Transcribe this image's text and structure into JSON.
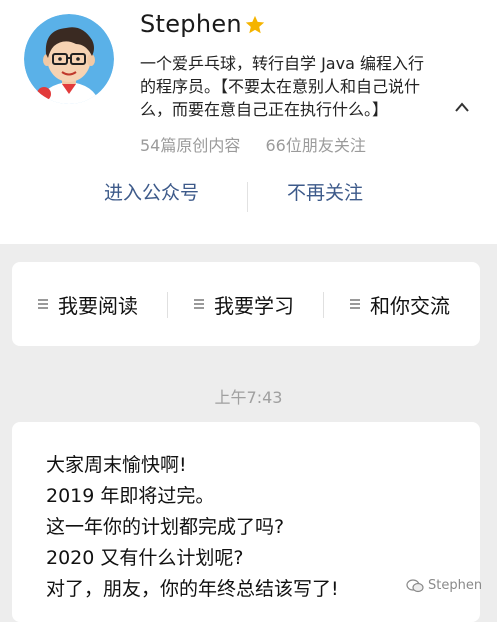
{
  "profile": {
    "name": "Stephen",
    "bio_line1": "一个爱乒乓球，转行自学 Java 编程入行",
    "bio_line2": "的程序员。【不要太在意别人和自己说什",
    "bio_line3": "么，而要在意自己正在执行什么。】",
    "original_count": "54篇原创内容",
    "friends_follow": "66位朋友关注"
  },
  "actions": {
    "enter": "进入公众号",
    "unfollow": "不再关注"
  },
  "menu": [
    {
      "label": "我要阅读"
    },
    {
      "label": "我要学习"
    },
    {
      "label": "和你交流"
    }
  ],
  "chat": {
    "time": "上午7:43",
    "lines": [
      "大家周末愉快啊!",
      "2019 年即将过完。",
      "这一年你的计划都完成了吗?",
      "2020 又有什么计划呢?",
      "对了，朋友，你的年终总结该写了!"
    ]
  },
  "watermark": {
    "text": "Stephen"
  },
  "colors": {
    "link": "#3d5a8a",
    "star": "#f5b400",
    "avatar_bg": "#5ab1e8"
  }
}
